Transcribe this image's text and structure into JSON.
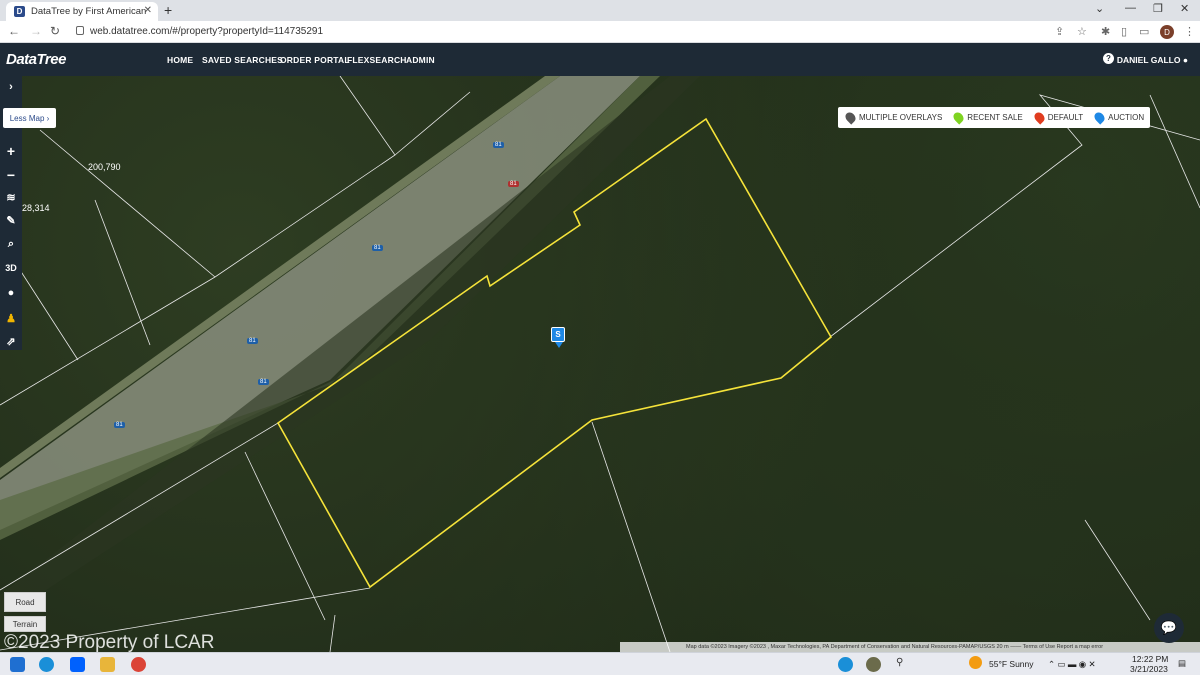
{
  "browser": {
    "tab_title": "DataTree by First American",
    "tab_favicon": "D",
    "url": "web.datatree.com/#/property?propertyId=114735291",
    "avatar_letter": "D"
  },
  "app": {
    "logo": "DataTree",
    "nav": [
      "HOME",
      "SAVED SEARCHES",
      "ORDER PORTAL",
      "FLEXSEARCH",
      "ADMIN"
    ],
    "user": "DANIEL GALLO"
  },
  "map": {
    "less_map_label": "Less Map",
    "tools": [
      "expand-icon",
      "zoom-in-icon",
      "zoom-out-icon",
      "layers-icon",
      "draw-icon",
      "search-icon",
      "3D",
      "globe-icon",
      "street-view-icon",
      "share-icon"
    ],
    "tool_3d_label": "3D",
    "legend": [
      {
        "label": "MULTIPLE OVERLAYS",
        "color": "#555555"
      },
      {
        "label": "RECENT SALE",
        "color": "#7ed321"
      },
      {
        "label": "DEFAULT",
        "color": "#e03c1f"
      },
      {
        "label": "AUCTION",
        "color": "#1e88e5"
      }
    ],
    "parcel_labels": [
      "200,790",
      "28,314"
    ],
    "highway_labels": [
      "81",
      "81",
      "81",
      "81",
      "81",
      "81"
    ],
    "pin_label": "S",
    "map_types": [
      "Road",
      "Terrain"
    ],
    "watermark": "©2023 Property of LCAR",
    "attribution": "Map data ©2023 Imagery ©2023 , Maxar Technologies, PA Department of Conservation and Natural Resources-PAMAP/USGS   20 m ——    Terms of Use   Report a map error"
  },
  "taskbar": {
    "weather": "55°F  Sunny",
    "time": "12:22 PM",
    "date": "3/21/2023"
  }
}
